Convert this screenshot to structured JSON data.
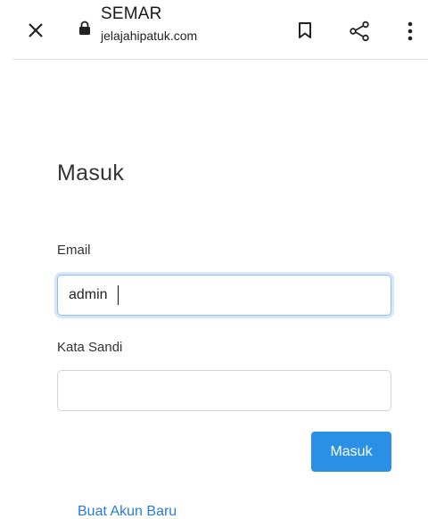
{
  "browser": {
    "site_title": "SEMAR",
    "site_url": "jelajahipatuk.com",
    "icons": {
      "close": "close-icon",
      "lock": "lock-icon",
      "bookmark": "bookmark-icon",
      "share": "share-icon",
      "menu": "more-vert-icon"
    }
  },
  "login": {
    "heading": "Masuk",
    "email_label": "Email",
    "email_value": "admin",
    "password_label": "Kata Sandi",
    "password_value": "",
    "submit_label": "Masuk",
    "register_link": "Buat Akun Baru"
  },
  "colors": {
    "primary_button": "#2a90e6",
    "link": "#2a7cd6",
    "focus_border": "#8fc0f0"
  }
}
